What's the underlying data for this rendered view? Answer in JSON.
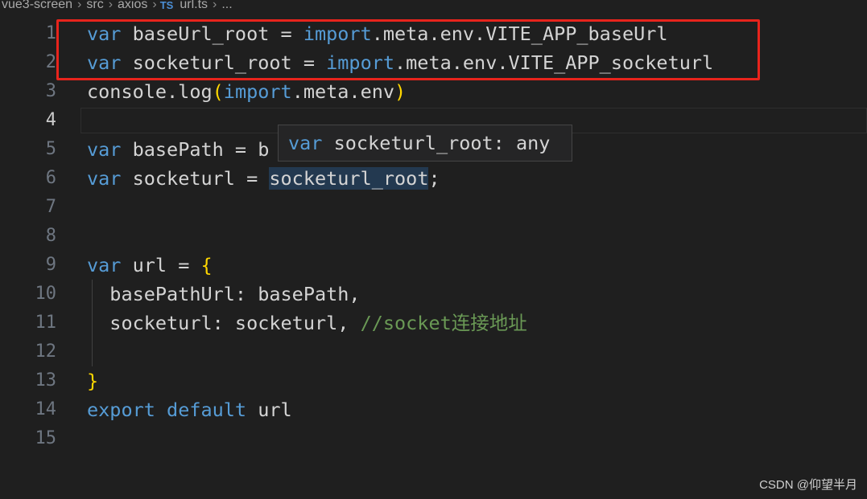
{
  "breadcrumb": {
    "items": [
      "vue3-screen",
      "src",
      "axios",
      "url.ts",
      "..."
    ],
    "file_type_badge": "TS"
  },
  "editor": {
    "active_line": 4,
    "lines": [
      {
        "number": "1",
        "text": "var baseUrl_root = import.meta.env.VITE_APP_baseUrl"
      },
      {
        "number": "2",
        "text": "var socketurl_root = import.meta.env.VITE_APP_socketurl"
      },
      {
        "number": "3",
        "text": "console.log(import.meta.env)"
      },
      {
        "number": "4",
        "text": ""
      },
      {
        "number": "5",
        "text": "var basePath = b"
      },
      {
        "number": "6",
        "text": "var socketurl = socketurl_root;"
      },
      {
        "number": "7",
        "text": ""
      },
      {
        "number": "8",
        "text": ""
      },
      {
        "number": "9",
        "text": "var url = {"
      },
      {
        "number": "10",
        "text": "basePathUrl: basePath,"
      },
      {
        "number": "11",
        "text": "socketurl: socketurl, //socket连接地址"
      },
      {
        "number": "12",
        "text": ""
      },
      {
        "number": "13",
        "text": "}"
      },
      {
        "number": "14",
        "text": "export default url"
      },
      {
        "number": "15",
        "text": ""
      }
    ]
  },
  "hover_tooltip": {
    "keyword": "var",
    "signature": "socketurl_root: any"
  },
  "watermark": "CSDN @仰望半月",
  "colors": {
    "background": "#1f1f1f",
    "keyword": "#569cd6",
    "bracket": "#ffd700",
    "comment": "#6a9955",
    "annotation_box": "#e8241c"
  }
}
